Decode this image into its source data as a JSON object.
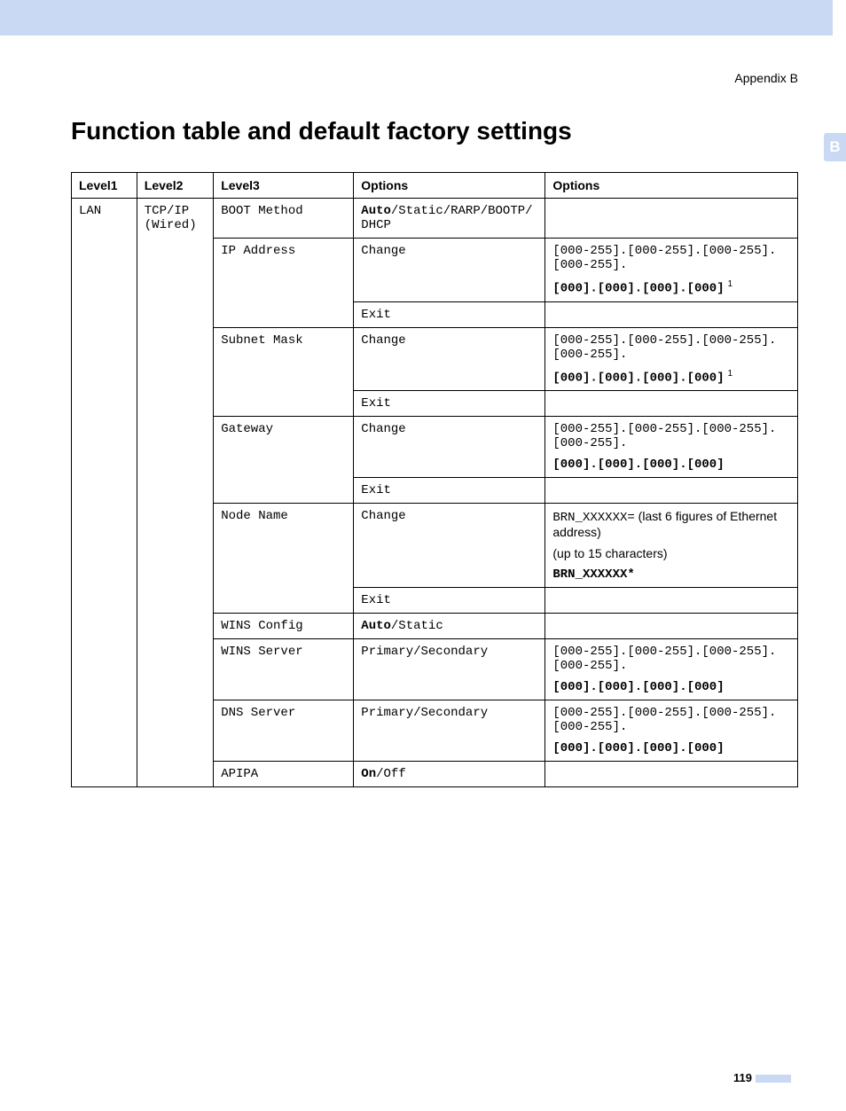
{
  "header": {
    "appendix": "Appendix B",
    "tab": "B"
  },
  "title": "Function table and default factory settings",
  "columns": {
    "c1": "Level1",
    "c2": "Level2",
    "c3": "Level3",
    "c4": "Options",
    "c5": "Options"
  },
  "l1": "LAN",
  "l2a": "TCP/IP",
  "l2b": "(Wired)",
  "boot": {
    "l3": "BOOT Method",
    "auto": "Auto",
    "rest": "/Static/RARP/BOOTP/ DHCP"
  },
  "ip": {
    "l3": "IP Address",
    "change": "Change",
    "exit": "Exit",
    "range": "[000-255].[000-255].[000-255].[000-255].",
    "def": "[000].[000].[000].[000]",
    "note": "1"
  },
  "subnet": {
    "l3": "Subnet Mask",
    "change": "Change",
    "exit": "Exit",
    "range": "[000-255].[000-255].[000-255].[000-255].",
    "def": "[000].[000].[000].[000]",
    "note": "1"
  },
  "gateway": {
    "l3": "Gateway",
    "change": "Change",
    "exit": "Exit",
    "range": "[000-255].[000-255].[000-255].[000-255].",
    "def": "[000].[000].[000].[000]"
  },
  "node": {
    "l3": "Node Name",
    "change": "Change",
    "exit": "Exit",
    "prefix": "BRN_XXXXXX=",
    "desc": " (last 6 figures of Ethernet address)",
    "limit": "(up to 15 characters)",
    "def": "BRN_XXXXXX*"
  },
  "winscfg": {
    "l3": "WINS Config",
    "auto": "Auto",
    "rest": "/Static"
  },
  "winssrv": {
    "l3": "WINS Server",
    "opt": "Primary/Secondary",
    "range": "[000-255].[000-255].[000-255].[000-255].",
    "def": "[000].[000].[000].[000]"
  },
  "dns": {
    "l3": "DNS Server",
    "opt": "Primary/Secondary",
    "range": "[000-255].[000-255].[000-255].[000-255].",
    "def": "[000].[000].[000].[000]"
  },
  "apipa": {
    "l3": "APIPA",
    "on": "On",
    "off": "/Off"
  },
  "page": "119"
}
